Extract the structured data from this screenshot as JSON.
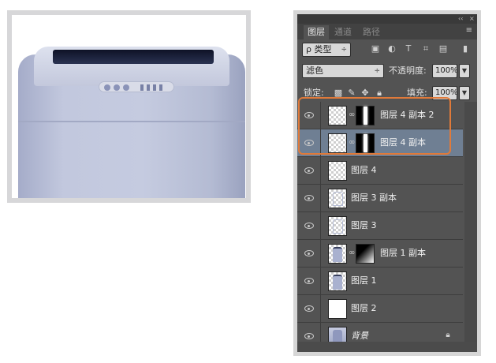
{
  "panel": {
    "tabs": [
      {
        "label": "图层",
        "active": true
      },
      {
        "label": "通道",
        "active": false
      },
      {
        "label": "路径",
        "active": false
      }
    ],
    "filter": {
      "kind_label": "ρ 类型",
      "arrow": "÷"
    },
    "filter_icons": [
      "image-filter-icon",
      "adjustment-filter-icon",
      "type-filter-icon",
      "shape-filter-icon",
      "smart-object-filter-icon",
      "filter-toggle-icon"
    ],
    "blend_mode": "滤色",
    "opacity_label": "不透明度:",
    "opacity_value": "100%",
    "lock_label": "锁定:",
    "fill_label": "填充:",
    "fill_value": "100%",
    "window_controls": {
      "collapse": "‹‹",
      "close": "×"
    }
  },
  "layers": [
    {
      "name": "图层 4 副本 2",
      "thumb": "checker",
      "mask": "bar",
      "selected": false
    },
    {
      "name": "图层 4 副本",
      "thumb": "checker",
      "mask": "bar",
      "selected": true
    },
    {
      "name": "图层 4",
      "thumb": "checker",
      "mask": null,
      "selected": false
    },
    {
      "name": "图层 3 副本",
      "thumb": "outline",
      "mask": null,
      "selected": false
    },
    {
      "name": "图层 3",
      "thumb": "outline",
      "mask": null,
      "selected": false
    },
    {
      "name": "图层 1 副本",
      "thumb": "machine",
      "mask": "gradient",
      "selected": false
    },
    {
      "name": "图层 1",
      "thumb": "machine",
      "mask": null,
      "selected": false
    },
    {
      "name": "图层 2",
      "thumb": "white",
      "mask": null,
      "selected": false
    },
    {
      "name": "背景",
      "thumb": "bg",
      "mask": null,
      "selected": false,
      "locked": true
    }
  ],
  "colors": {
    "highlight": "#e07a3a",
    "selected_row": "#6f7f93",
    "panel_bg": "#535353"
  }
}
